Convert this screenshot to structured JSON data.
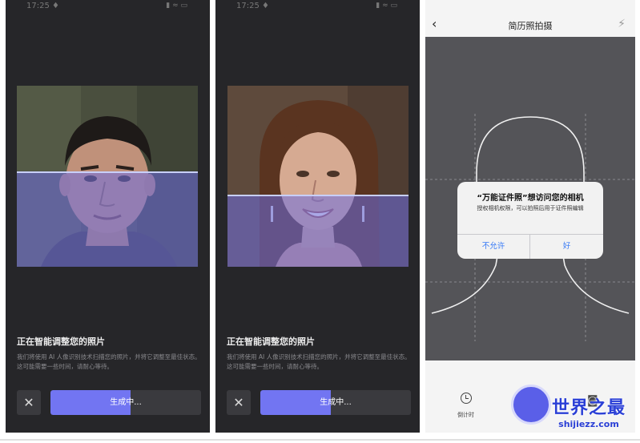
{
  "screens": [
    {
      "status_time": "17:25 ♦",
      "status_icons": "▮ ≈ ▭",
      "title": "正在智能调整您的照片",
      "description": "我们将使用 AI 人像识别技术扫描您的照片，并将它调整至最佳状态。这可能需要一些时间，请耐心等待。",
      "close_glyph": "✕",
      "button_label": "生成中...",
      "progress": 0.53
    },
    {
      "status_time": "17:25 ♦",
      "status_icons": "▮ ≈ ▭",
      "title": "正在智能调整您的照片",
      "description": "我们将使用 AI 人像识别技术扫描您的照片，并将它调整至最佳状态。这可能需要一些时间，请耐心等待。",
      "close_glyph": "✕",
      "button_label": "生成中...",
      "progress": 0.47
    }
  ],
  "camera_screen": {
    "back_glyph": "‹",
    "title": "简历照拍摄",
    "flash_glyph": "⚡",
    "dialog": {
      "title": "“万能证件照”想访问您的相机",
      "message": "授权相机权限，可以拍照后用于证件照编辑",
      "deny_label": "不允许",
      "allow_label": "好"
    },
    "timer_label": "倒计时",
    "camera_glyph": "◙"
  },
  "watermark": {
    "top": "世界之最",
    "bottom": "shijiezz.com"
  },
  "icons": [
    "close-icon",
    "back-icon",
    "flash-off-icon",
    "timer-icon",
    "shutter-button",
    "switch-camera-icon"
  ],
  "colors": {
    "accent": "#7275f2",
    "dark_bg": "#262629",
    "dialog_button": "#3478f6",
    "watermark": "#2a3fd6"
  }
}
